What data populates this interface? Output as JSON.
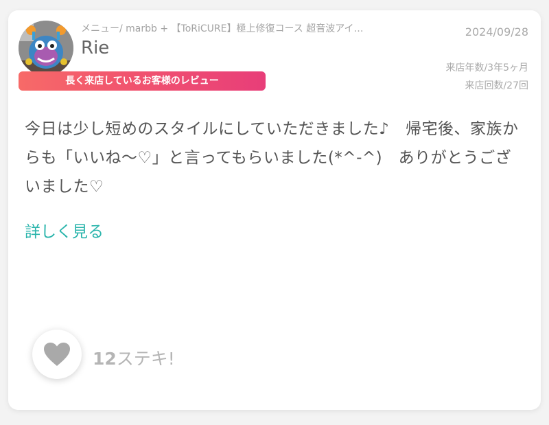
{
  "review": {
    "menu": "メニュー/ marbb + 【ToRiCURE】極上修復コース 超音波アイ…",
    "user_name": "Rie",
    "date": "2024/09/28",
    "visit_years": "来店年数/3年5ヶ月",
    "visit_count": "来店回数/27回",
    "badge": "長く来店しているお客様のレビュー",
    "body": "今日は少し短めのスタイルにしていただきました♪　帰宅後、家族からも「いいね〜♡」と言ってもらいました(*^-^)　ありがとうございました♡",
    "more_link": "詳しく見る",
    "likes_count": "12",
    "likes_label": "ステキ!"
  },
  "icons": {
    "avatar": "monster-plush-avatar",
    "like": "heart-icon"
  },
  "colors": {
    "badge_start": "#f76a68",
    "badge_end": "#e83e79",
    "link": "#2bb5ac",
    "heart": "#a9a9a9"
  }
}
